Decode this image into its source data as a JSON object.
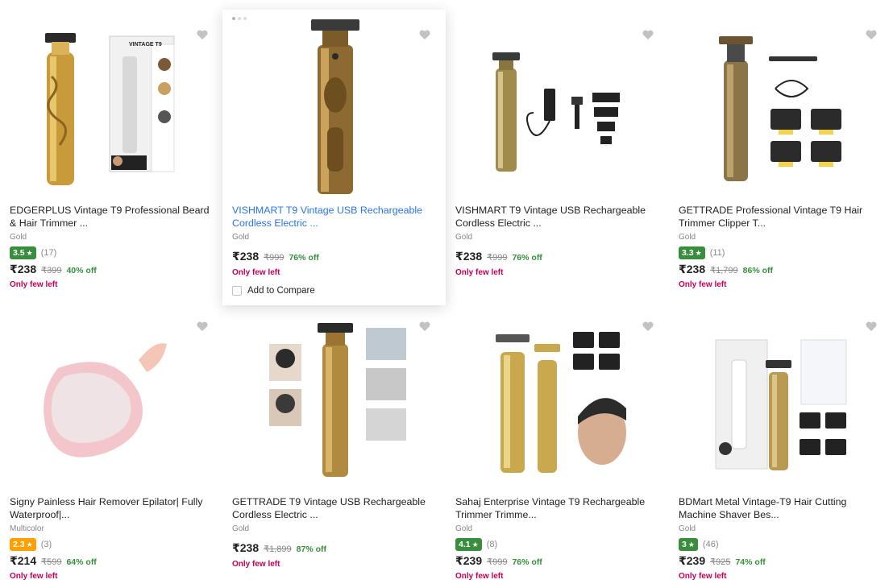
{
  "products": [
    {
      "title": "EDGERPLUS Vintage T9 Professional Beard & Hair Trimmer ...",
      "color": "Gold",
      "rating": "3.5",
      "reviews": "(17)",
      "price": "₹238",
      "mrp": "₹399",
      "discount": "40% off",
      "stock": "Only few left",
      "rating_color": "#388e3c"
    },
    {
      "title": "VISHMART T9 Vintage USB Rechargeable Cordless Electric ...",
      "color": "Gold",
      "rating": "",
      "reviews": "",
      "price": "₹238",
      "mrp": "₹999",
      "discount": "76% off",
      "stock": "Only few left",
      "compare": "Add to Compare"
    },
    {
      "title": "VISHMART T9 Vintage USB Rechargeable Cordless Electric ...",
      "color": "Gold",
      "rating": "",
      "reviews": "",
      "price": "₹238",
      "mrp": "₹999",
      "discount": "76% off",
      "stock": "Only few left"
    },
    {
      "title": "GETTRADE Professional Vintage T9 Hair Trimmer Clipper T...",
      "color": "Gold",
      "rating": "3.3",
      "reviews": "(11)",
      "price": "₹238",
      "mrp": "₹1,799",
      "discount": "86% off",
      "stock": "Only few left",
      "rating_color": "#388e3c"
    },
    {
      "title": "Signy Painless Hair Remover Epilator| Fully Waterproof|...",
      "color": "Multicolor",
      "rating": "2.3",
      "reviews": "(3)",
      "price": "₹214",
      "mrp": "₹599",
      "discount": "64% off",
      "stock": "Only few left",
      "rating_color": "#ff9f00"
    },
    {
      "title": "GETTRADE T9 Vintage USB Rechargeable Cordless Electric ...",
      "color": "Gold",
      "rating": "",
      "reviews": "",
      "price": "₹238",
      "mrp": "₹1,899",
      "discount": "87% off",
      "stock": "Only few left"
    },
    {
      "title": "Sahaj Enterprise Vintage T9 Rechargeable Trimmer Trimme...",
      "color": "Gold",
      "rating": "4.1",
      "reviews": "(8)",
      "price": "₹239",
      "mrp": "₹999",
      "discount": "76% off",
      "stock": "Only few left",
      "rating_color": "#388e3c"
    },
    {
      "title": "BDMart Metal Vintage-T9 Hair Cutting Machine Shaver Bes...",
      "color": "Gold",
      "rating": "3",
      "reviews": "(46)",
      "price": "₹239",
      "mrp": "₹925",
      "discount": "74% off",
      "stock": "Only few left",
      "rating_color": "#388e3c"
    }
  ],
  "box_label": "VINTAGE T9",
  "icons": {
    "wishlist": "heart-icon",
    "rating": "star-icon",
    "compare": "checkbox"
  }
}
